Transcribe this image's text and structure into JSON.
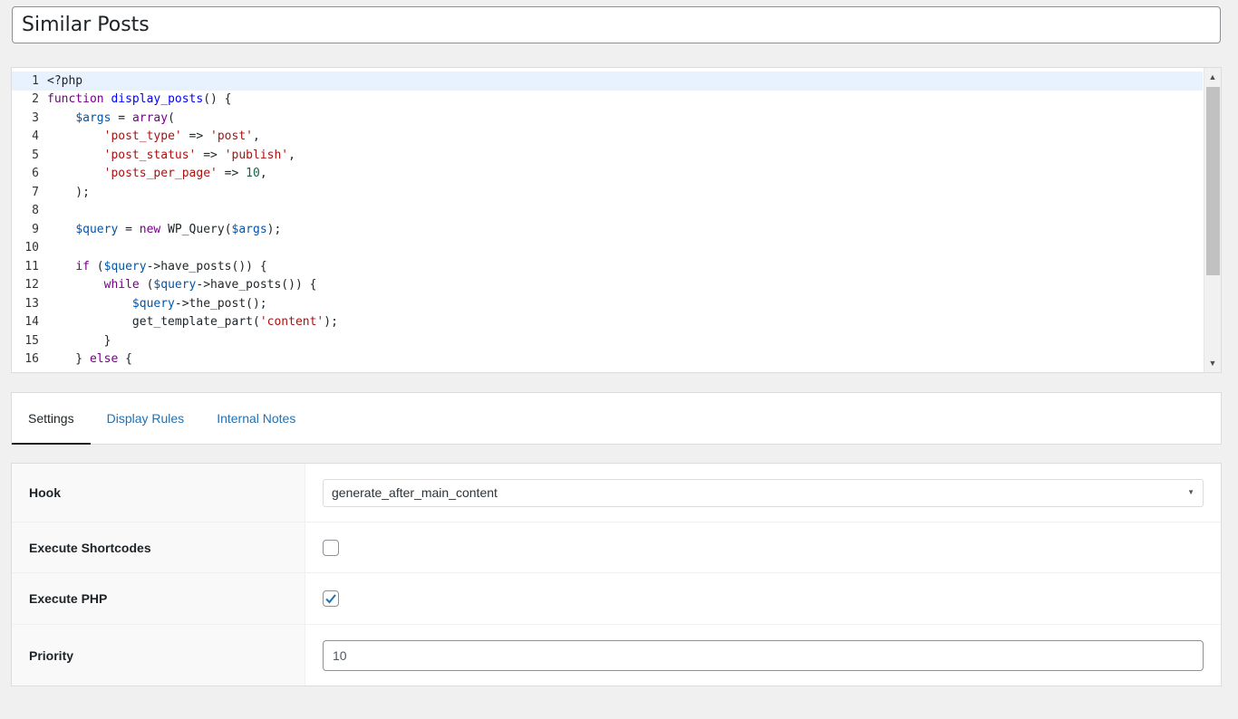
{
  "post": {
    "title": "Similar Posts"
  },
  "editor": {
    "lines": [
      [
        [
          "plain",
          "<?php"
        ]
      ],
      [
        [
          "kw",
          "function "
        ],
        [
          "def",
          "display_posts"
        ],
        [
          "plain",
          "() {"
        ]
      ],
      [
        [
          "plain",
          "    "
        ],
        [
          "var",
          "$args"
        ],
        [
          "plain",
          " = "
        ],
        [
          "kw",
          "array"
        ],
        [
          "plain",
          "("
        ]
      ],
      [
        [
          "plain",
          "        "
        ],
        [
          "str",
          "'post_type'"
        ],
        [
          "plain",
          " => "
        ],
        [
          "str",
          "'post'"
        ],
        [
          "plain",
          ","
        ]
      ],
      [
        [
          "plain",
          "        "
        ],
        [
          "str",
          "'post_status'"
        ],
        [
          "plain",
          " => "
        ],
        [
          "str",
          "'publish'"
        ],
        [
          "plain",
          ","
        ]
      ],
      [
        [
          "plain",
          "        "
        ],
        [
          "str",
          "'posts_per_page'"
        ],
        [
          "plain",
          " => "
        ],
        [
          "num",
          "10"
        ],
        [
          "plain",
          ","
        ]
      ],
      [
        [
          "plain",
          "    );"
        ]
      ],
      [
        [
          "plain",
          ""
        ]
      ],
      [
        [
          "plain",
          "    "
        ],
        [
          "var",
          "$query"
        ],
        [
          "plain",
          " = "
        ],
        [
          "kw",
          "new"
        ],
        [
          "plain",
          " WP_Query("
        ],
        [
          "var",
          "$args"
        ],
        [
          "plain",
          ");"
        ]
      ],
      [
        [
          "plain",
          ""
        ]
      ],
      [
        [
          "plain",
          "    "
        ],
        [
          "kw",
          "if"
        ],
        [
          "plain",
          " ("
        ],
        [
          "var",
          "$query"
        ],
        [
          "plain",
          "->have_posts()) {"
        ]
      ],
      [
        [
          "plain",
          "        "
        ],
        [
          "kw",
          "while"
        ],
        [
          "plain",
          " ("
        ],
        [
          "var",
          "$query"
        ],
        [
          "plain",
          "->have_posts()) {"
        ]
      ],
      [
        [
          "plain",
          "            "
        ],
        [
          "var",
          "$query"
        ],
        [
          "plain",
          "->the_post();"
        ]
      ],
      [
        [
          "plain",
          "            get_template_part("
        ],
        [
          "str",
          "'content'"
        ],
        [
          "plain",
          ");"
        ]
      ],
      [
        [
          "plain",
          "        }"
        ]
      ],
      [
        [
          "plain",
          "    } "
        ],
        [
          "kw",
          "else"
        ],
        [
          "plain",
          " {"
        ]
      ]
    ],
    "scroll_up_icon": "triangle-up",
    "scroll_down_icon": "triangle-down"
  },
  "tabs": [
    {
      "label": "Settings",
      "active": true
    },
    {
      "label": "Display Rules",
      "active": false
    },
    {
      "label": "Internal Notes",
      "active": false
    }
  ],
  "settings": {
    "hook": {
      "label": "Hook",
      "value": "generate_after_main_content"
    },
    "execute_shortcodes": {
      "label": "Execute Shortcodes",
      "checked": false
    },
    "execute_php": {
      "label": "Execute PHP",
      "checked": true
    },
    "priority": {
      "label": "Priority",
      "value": "10"
    }
  },
  "colors": {
    "link": "#2271b1",
    "check": "#2271b1",
    "active_line": "#e8f2fe"
  }
}
